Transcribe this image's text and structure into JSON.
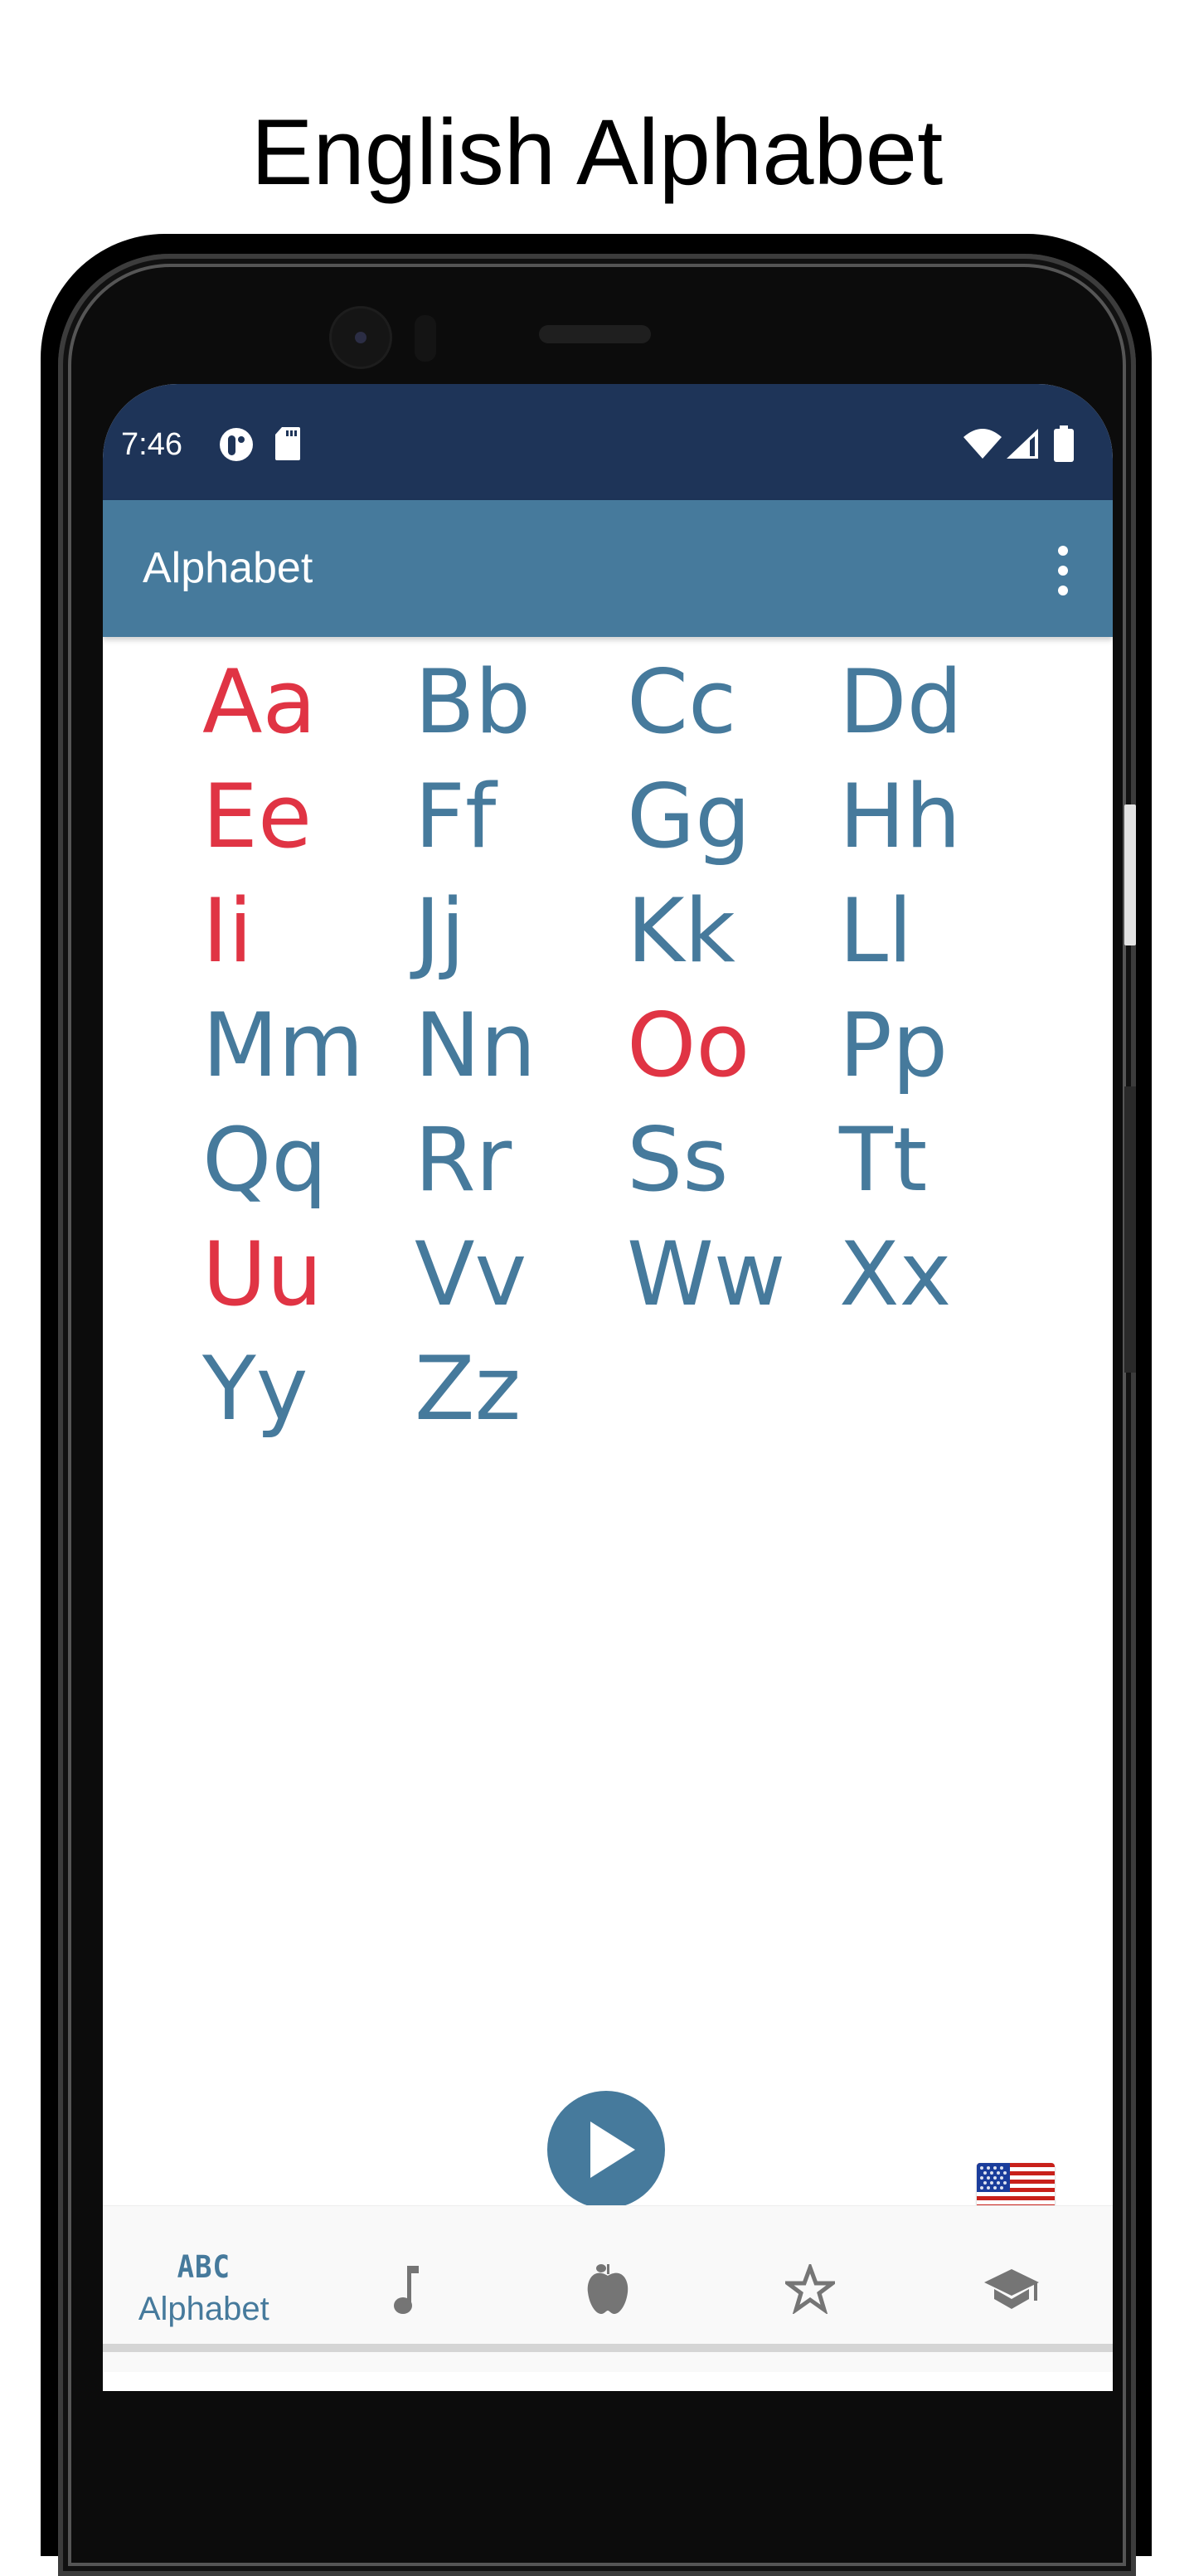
{
  "page_title": "English Alphabet",
  "status_bar": {
    "time": "7:46",
    "icons": [
      "app-notification-icon",
      "sd-card-icon",
      "wifi-icon",
      "cell-signal-icon",
      "battery-icon"
    ]
  },
  "app_bar": {
    "title": "Alphabet",
    "menu_icon": "more-vert-icon"
  },
  "colors": {
    "status_bar": "#1e3458",
    "app_bar": "#467a9c",
    "consonant": "#467a9c",
    "vowel": "#e03444"
  },
  "letters": [
    {
      "text": "Aa",
      "vowel": true
    },
    {
      "text": "Bb",
      "vowel": false
    },
    {
      "text": "Cc",
      "vowel": false
    },
    {
      "text": "Dd",
      "vowel": false
    },
    {
      "text": "Ee",
      "vowel": true
    },
    {
      "text": "Ff",
      "vowel": false
    },
    {
      "text": "Gg",
      "vowel": false
    },
    {
      "text": "Hh",
      "vowel": false
    },
    {
      "text": "Ii",
      "vowel": true
    },
    {
      "text": "Jj",
      "vowel": false
    },
    {
      "text": "Kk",
      "vowel": false
    },
    {
      "text": "Ll",
      "vowel": false
    },
    {
      "text": "Mm",
      "vowel": false
    },
    {
      "text": "Nn",
      "vowel": false
    },
    {
      "text": "Oo",
      "vowel": true
    },
    {
      "text": "Pp",
      "vowel": false
    },
    {
      "text": "Qq",
      "vowel": false
    },
    {
      "text": "Rr",
      "vowel": false
    },
    {
      "text": "Ss",
      "vowel": false
    },
    {
      "text": "Tt",
      "vowel": false
    },
    {
      "text": "Uu",
      "vowel": true
    },
    {
      "text": "Vv",
      "vowel": false
    },
    {
      "text": "Ww",
      "vowel": false
    },
    {
      "text": "Xx",
      "vowel": false
    },
    {
      "text": "Yy",
      "vowel": false
    },
    {
      "text": "Zz",
      "vowel": false
    }
  ],
  "controls": {
    "play_icon": "play-icon",
    "language_flag": "us-flag-icon"
  },
  "bottom_nav": {
    "items": [
      {
        "icon": "abc-icon",
        "icon_text": "ABC",
        "label": "Alphabet",
        "active": true
      },
      {
        "icon": "music-note-icon",
        "label": "",
        "active": false
      },
      {
        "icon": "apple-icon",
        "label": "",
        "active": false
      },
      {
        "icon": "star-icon",
        "label": "",
        "active": false
      },
      {
        "icon": "graduation-cap-icon",
        "label": "",
        "active": false
      }
    ]
  }
}
